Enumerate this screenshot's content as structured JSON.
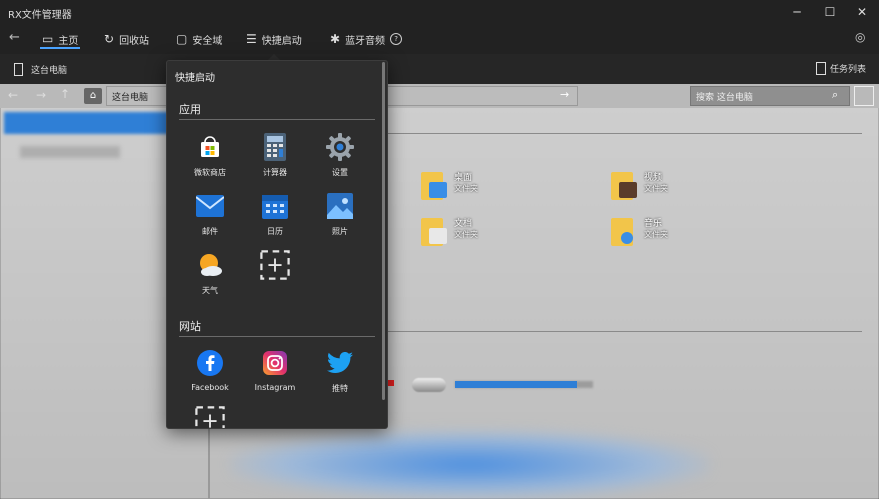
{
  "window": {
    "title": "RX文件管理器",
    "minimize": "─",
    "maximize": "☐",
    "close": "✕"
  },
  "nav": {
    "back": "←",
    "items": [
      {
        "label": "主页",
        "icon": "home-icon"
      },
      {
        "label": "回收站",
        "icon": "recycle-bin-icon"
      },
      {
        "label": "安全域",
        "icon": "lock-folder-icon"
      },
      {
        "label": "快捷启动",
        "icon": "quick-launch-icon"
      },
      {
        "label": "蓝牙音频",
        "icon": "bluetooth-icon"
      }
    ],
    "help": "?",
    "settings": "◎"
  },
  "tab": {
    "label": "这台电脑",
    "tasklist": "任务列表"
  },
  "address": {
    "path": "这台电脑",
    "go": "→",
    "search_placeholder": "搜索 这台电脑",
    "search_icon": "⌕"
  },
  "folders": [
    {
      "name": "桌面",
      "type": "文件夹"
    },
    {
      "name": "视频",
      "type": "文件夹"
    },
    {
      "name": "文档",
      "type": "文件夹"
    },
    {
      "name": "音乐",
      "type": "文件夹"
    }
  ],
  "popup": {
    "title": "快捷启动",
    "apps_header": "应用",
    "apps": [
      "微软商店",
      "计算器",
      "设置",
      "邮件",
      "日历",
      "照片",
      "天气"
    ],
    "web_header": "网站",
    "sites": [
      "Facebook",
      "Instagram",
      "推特"
    ]
  },
  "colors": {
    "accent": "#4aa3ff",
    "selection": "#2f7fd6",
    "popup_bg": "#2d2d2d"
  }
}
